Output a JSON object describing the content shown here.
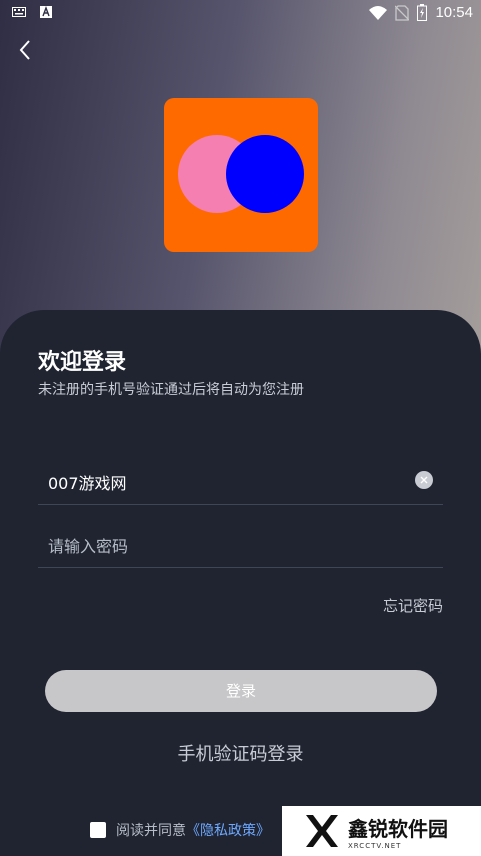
{
  "status_bar": {
    "time": "10:54",
    "left_icons": [
      "keyboard-icon",
      "text-a-icon"
    ],
    "right_icons": [
      "wifi-icon",
      "no-sim-icon",
      "battery-charging-icon"
    ]
  },
  "header": {
    "back_icon": "chevron-left-icon"
  },
  "logo": {
    "colors": {
      "bg": "#ff6a00",
      "left_circle": "#f57fb0",
      "right_circle": "#0000ff"
    }
  },
  "login": {
    "title": "欢迎登录",
    "subtitle": "未注册的手机号验证通过后将自动为您注册",
    "account_value": "007游戏网",
    "password_placeholder": "请输入密码",
    "forgot_password": "忘记密码",
    "login_button": "登录",
    "sms_login": "手机验证码登录",
    "agreement_prefix": "阅读并同意",
    "privacy_policy": "《隐私政策》"
  },
  "watermark": {
    "name": "鑫锐软件园",
    "domain": "XRCCTV.NET"
  },
  "colors": {
    "panel": "#1f2430",
    "button": "#c7c7c9",
    "link": "#6ea8ff"
  }
}
